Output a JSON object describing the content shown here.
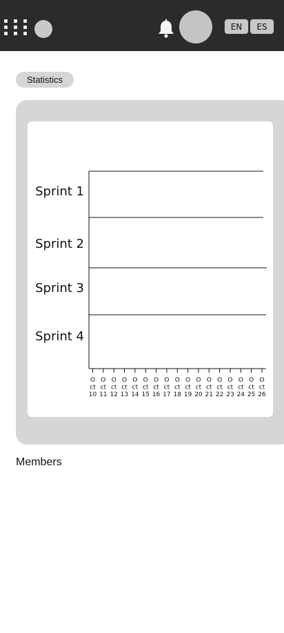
{
  "header": {
    "language_en": "EN",
    "language_es": "ES"
  },
  "section": {
    "statistics_label": "Statistics",
    "members_label": "Members"
  },
  "chart_data": {
    "type": "bar",
    "orientation": "horizontal",
    "categories": [
      "Sprint 1",
      "Sprint 2",
      "Sprint 3",
      "Sprint 4"
    ],
    "x_tick_labels": [
      [
        "O",
        "ct",
        "10"
      ],
      [
        "O",
        "ct",
        "11"
      ],
      [
        "O",
        "ct",
        "12"
      ],
      [
        "O",
        "ct",
        "13"
      ],
      [
        "O",
        "ct",
        "14"
      ],
      [
        "O",
        "ct",
        "15"
      ],
      [
        "O",
        "ct",
        "16"
      ],
      [
        "O",
        "ct",
        "17"
      ],
      [
        "O",
        "ct",
        "18"
      ],
      [
        "O",
        "ct",
        "19"
      ],
      [
        "O",
        "ct",
        "20"
      ],
      [
        "O",
        "ct",
        "21"
      ],
      [
        "O",
        "ct",
        "22"
      ],
      [
        "O",
        "ct",
        "23"
      ],
      [
        "O",
        "ct",
        "24"
      ],
      [
        "O",
        "ct",
        "25"
      ],
      [
        "O",
        "ct",
        "26"
      ]
    ],
    "grid": false,
    "legend": "none"
  },
  "colors": {
    "topbar": "#2b2b2b",
    "panel": "#d6d6d6",
    "avatar": "#c4c4c4"
  }
}
